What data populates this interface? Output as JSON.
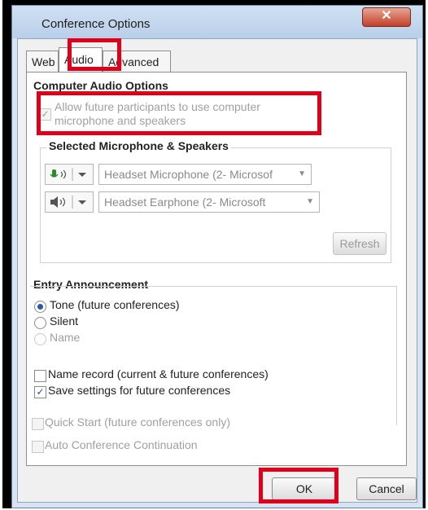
{
  "window": {
    "title": "Conference Options",
    "close_glyph": "✕"
  },
  "tabs": [
    {
      "label": "Web"
    },
    {
      "label": "Audio",
      "active": true
    },
    {
      "label": "Advanced"
    }
  ],
  "computer_audio": {
    "heading": "Computer Audio Options",
    "allow_label": "Allow future participants to use computer microphone and speakers",
    "allow_checked": true,
    "devices_heading": "Selected Microphone & Speakers",
    "microphone": {
      "icon": "microphone-icon",
      "value": "Headset Microphone (2- Microsof"
    },
    "speaker": {
      "icon": "speaker-icon",
      "value": "Headset Earphone (2- Microsoft"
    },
    "refresh_label": "Refresh"
  },
  "entry": {
    "heading": "Entry Announcement",
    "options": [
      {
        "label": "Tone (future conferences)",
        "selected": true,
        "enabled": true
      },
      {
        "label": "Silent",
        "selected": false,
        "enabled": true
      },
      {
        "label": "Name",
        "selected": false,
        "enabled": false
      }
    ],
    "name_record_label": "Name record (current & future conferences)",
    "name_record_checked": false,
    "save_settings_label": "Save settings for future conferences",
    "save_settings_checked": true
  },
  "extra": {
    "quick_start_label": "Quick Start (future conferences only)",
    "auto_continuation_label": "Auto Conference Continuation"
  },
  "buttons": {
    "ok": "OK",
    "cancel": "Cancel"
  },
  "highlight_color": "#e1001a"
}
